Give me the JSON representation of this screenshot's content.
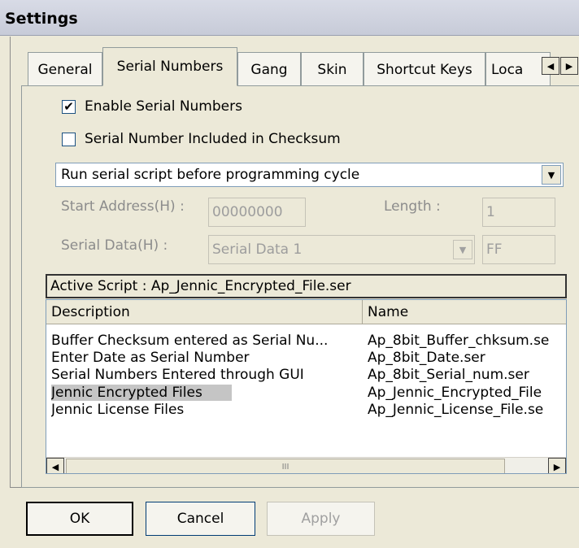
{
  "window": {
    "title": "Settings"
  },
  "tabs": [
    {
      "label": "General"
    },
    {
      "label": "Serial Numbers",
      "active": true
    },
    {
      "label": "Gang"
    },
    {
      "label": "Skin"
    },
    {
      "label": "Shortcut Keys"
    },
    {
      "label": "Loca"
    }
  ],
  "serial": {
    "enable_label": "Enable Serial Numbers",
    "enable_checked": true,
    "checksum_label": "Serial Number Included in Checksum",
    "checksum_checked": false,
    "script_mode": "Run serial script before programming cycle",
    "start_address_label": "Start Address(H) :",
    "start_address_value": "00000000",
    "length_label": "Length :",
    "length_value": "1",
    "serial_data_label": "Serial Data(H) :",
    "serial_data_value": "Serial Data  1",
    "serial_data_byte": "FF"
  },
  "script": {
    "active_label": "Active Script : Ap_Jennic_Encrypted_File.ser",
    "columns": [
      "Description",
      "Name"
    ],
    "rows": [
      {
        "description": "Buffer Checksum entered as Serial Nu...",
        "name": "Ap_8bit_Buffer_chksum.se"
      },
      {
        "description": "Enter Date as Serial Number",
        "name": "Ap_8bit_Date.ser"
      },
      {
        "description": "Serial Numbers Entered through GUI",
        "name": "Ap_8bit_Serial_num.ser"
      },
      {
        "description": "Jennic Encrypted Files",
        "name": "Ap_Jennic_Encrypted_File",
        "selected": true
      },
      {
        "description": "Jennic License Files",
        "name": "Ap_Jennic_License_File.se"
      }
    ],
    "scroll_thumb": "III"
  },
  "buttons": {
    "ok": "OK",
    "cancel": "Cancel",
    "apply": "Apply"
  },
  "icons": {
    "check": "✔",
    "dropdown": "▼",
    "scroll_left": "◀",
    "scroll_right": "▶"
  }
}
